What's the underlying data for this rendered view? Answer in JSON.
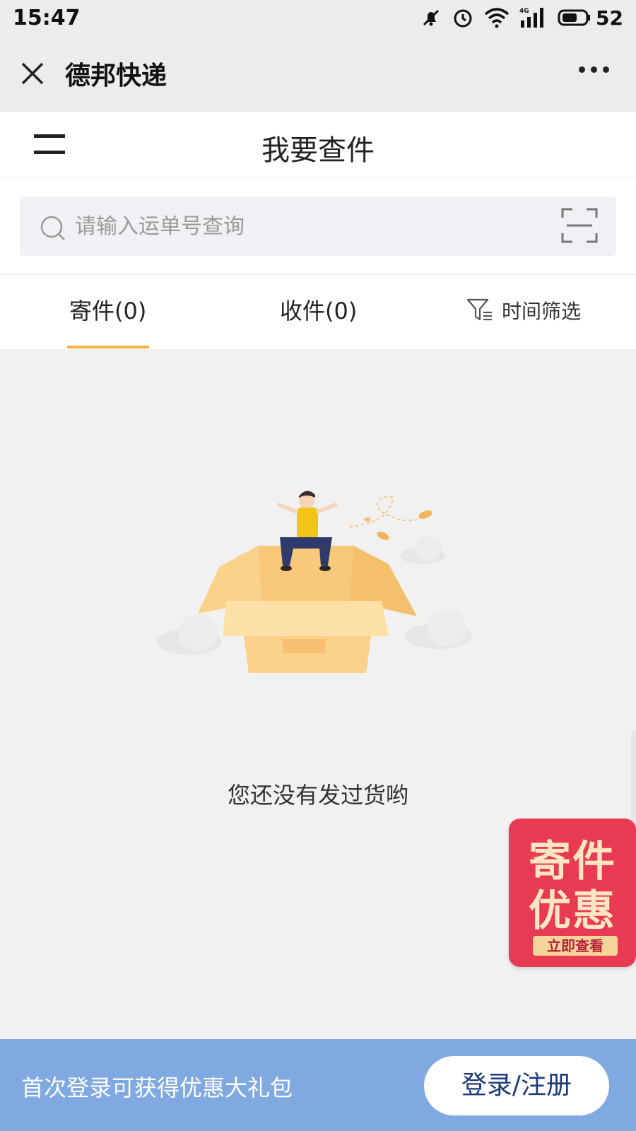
{
  "status_bar": {
    "time": "15:47",
    "battery": "52",
    "network": "4G"
  },
  "titlebar": {
    "title": "德邦快递"
  },
  "page": {
    "title": "我要查件"
  },
  "search": {
    "placeholder": "请输入运单号查询"
  },
  "tabs": [
    {
      "label": "寄件(0)",
      "active": true
    },
    {
      "label": "收件(0)",
      "active": false
    }
  ],
  "filter": {
    "label": "时间筛选"
  },
  "empty": {
    "message": "您还没有发过货哟"
  },
  "promo": {
    "line1": "寄件",
    "line2": "优惠",
    "button": "立即查看"
  },
  "bottom_bar": {
    "message": "首次登录可获得优惠大礼包",
    "button": "登录/注册"
  },
  "colors": {
    "accent_underline": "#f0b43c",
    "promo_bg": "#e83a52",
    "bottom_bar_bg": "#80a9e2"
  }
}
